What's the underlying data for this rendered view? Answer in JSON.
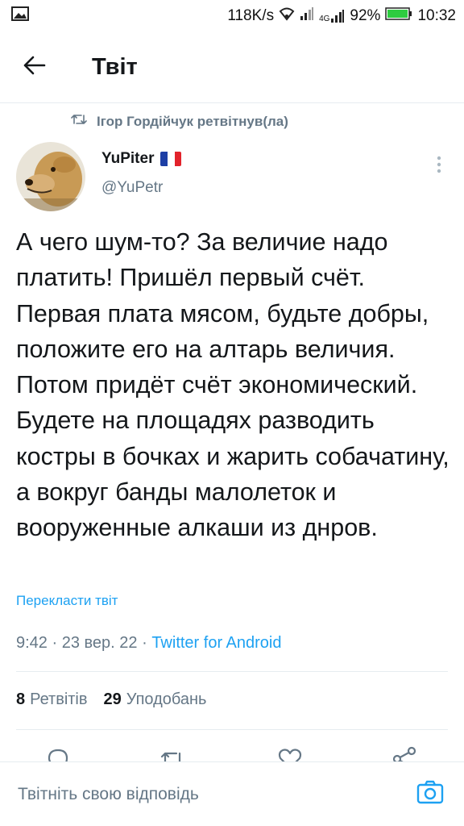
{
  "status_bar": {
    "speed": "118K/s",
    "network": "4G",
    "battery": "92%",
    "time": "10:32",
    "icons": [
      "image-icon",
      "wifi-icon",
      "signal-icon",
      "signal-4g-icon",
      "battery-icon"
    ]
  },
  "header": {
    "title": "Твіт",
    "back_icon": "arrow-left-icon"
  },
  "retweet_context": {
    "text": "Ігор Гордійчук ретвітнув(ла)",
    "icon": "retweet-icon"
  },
  "author": {
    "display_name": "YuPiter",
    "flag": "france-flag",
    "handle": "@YuPetr"
  },
  "tweet": {
    "text": "А чего шум-то? За величие надо платить! Пришёл первый счёт. Первая плата мясом, будьте добры, положите его на алтарь величия. Потом придёт счёт экономический. Будете на площадях разводить костры в бочках и жарить собачатину, а вокруг банды малолеток и вооруженные алкаши из днров.",
    "translate_label": "Перекласти твіт",
    "time": "9:42",
    "date": "23 вер. 22",
    "separator": " · ",
    "source": "Twitter for Android"
  },
  "stats": {
    "retweets_count": "8",
    "retweets_label": "Ретвітів",
    "likes_count": "29",
    "likes_label": "Уподобань"
  },
  "actions": [
    "reply-icon",
    "retweet-icon",
    "like-icon",
    "share-icon"
  ],
  "reply_bar": {
    "placeholder": "Твітніть свою відповідь",
    "camera_icon": "camera-icon"
  },
  "colors": {
    "accent": "#1da1f2",
    "secondary_text": "#657786",
    "primary_text": "#14171a",
    "divider": "#e6ecf0",
    "battery": "#2ecc40"
  }
}
